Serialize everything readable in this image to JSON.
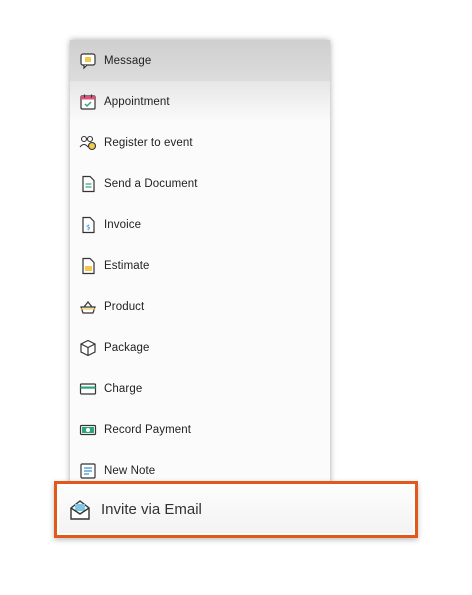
{
  "menu": {
    "items": [
      {
        "label": "Message",
        "icon": "message-icon"
      },
      {
        "label": "Appointment",
        "icon": "calendar-icon"
      },
      {
        "label": "Register to event",
        "icon": "people-icon"
      },
      {
        "label": "Send a Document",
        "icon": "document-icon"
      },
      {
        "label": "Invoice",
        "icon": "invoice-icon"
      },
      {
        "label": "Estimate",
        "icon": "estimate-icon"
      },
      {
        "label": "Product",
        "icon": "basket-icon"
      },
      {
        "label": "Package",
        "icon": "package-icon"
      },
      {
        "label": "Charge",
        "icon": "credit-card-icon"
      },
      {
        "label": "Record Payment",
        "icon": "cash-icon"
      },
      {
        "label": "New Note",
        "icon": "note-icon"
      }
    ]
  },
  "highlighted": {
    "label": "Invite via Email",
    "icon": "envelope-icon",
    "border_color": "#e0581a"
  }
}
